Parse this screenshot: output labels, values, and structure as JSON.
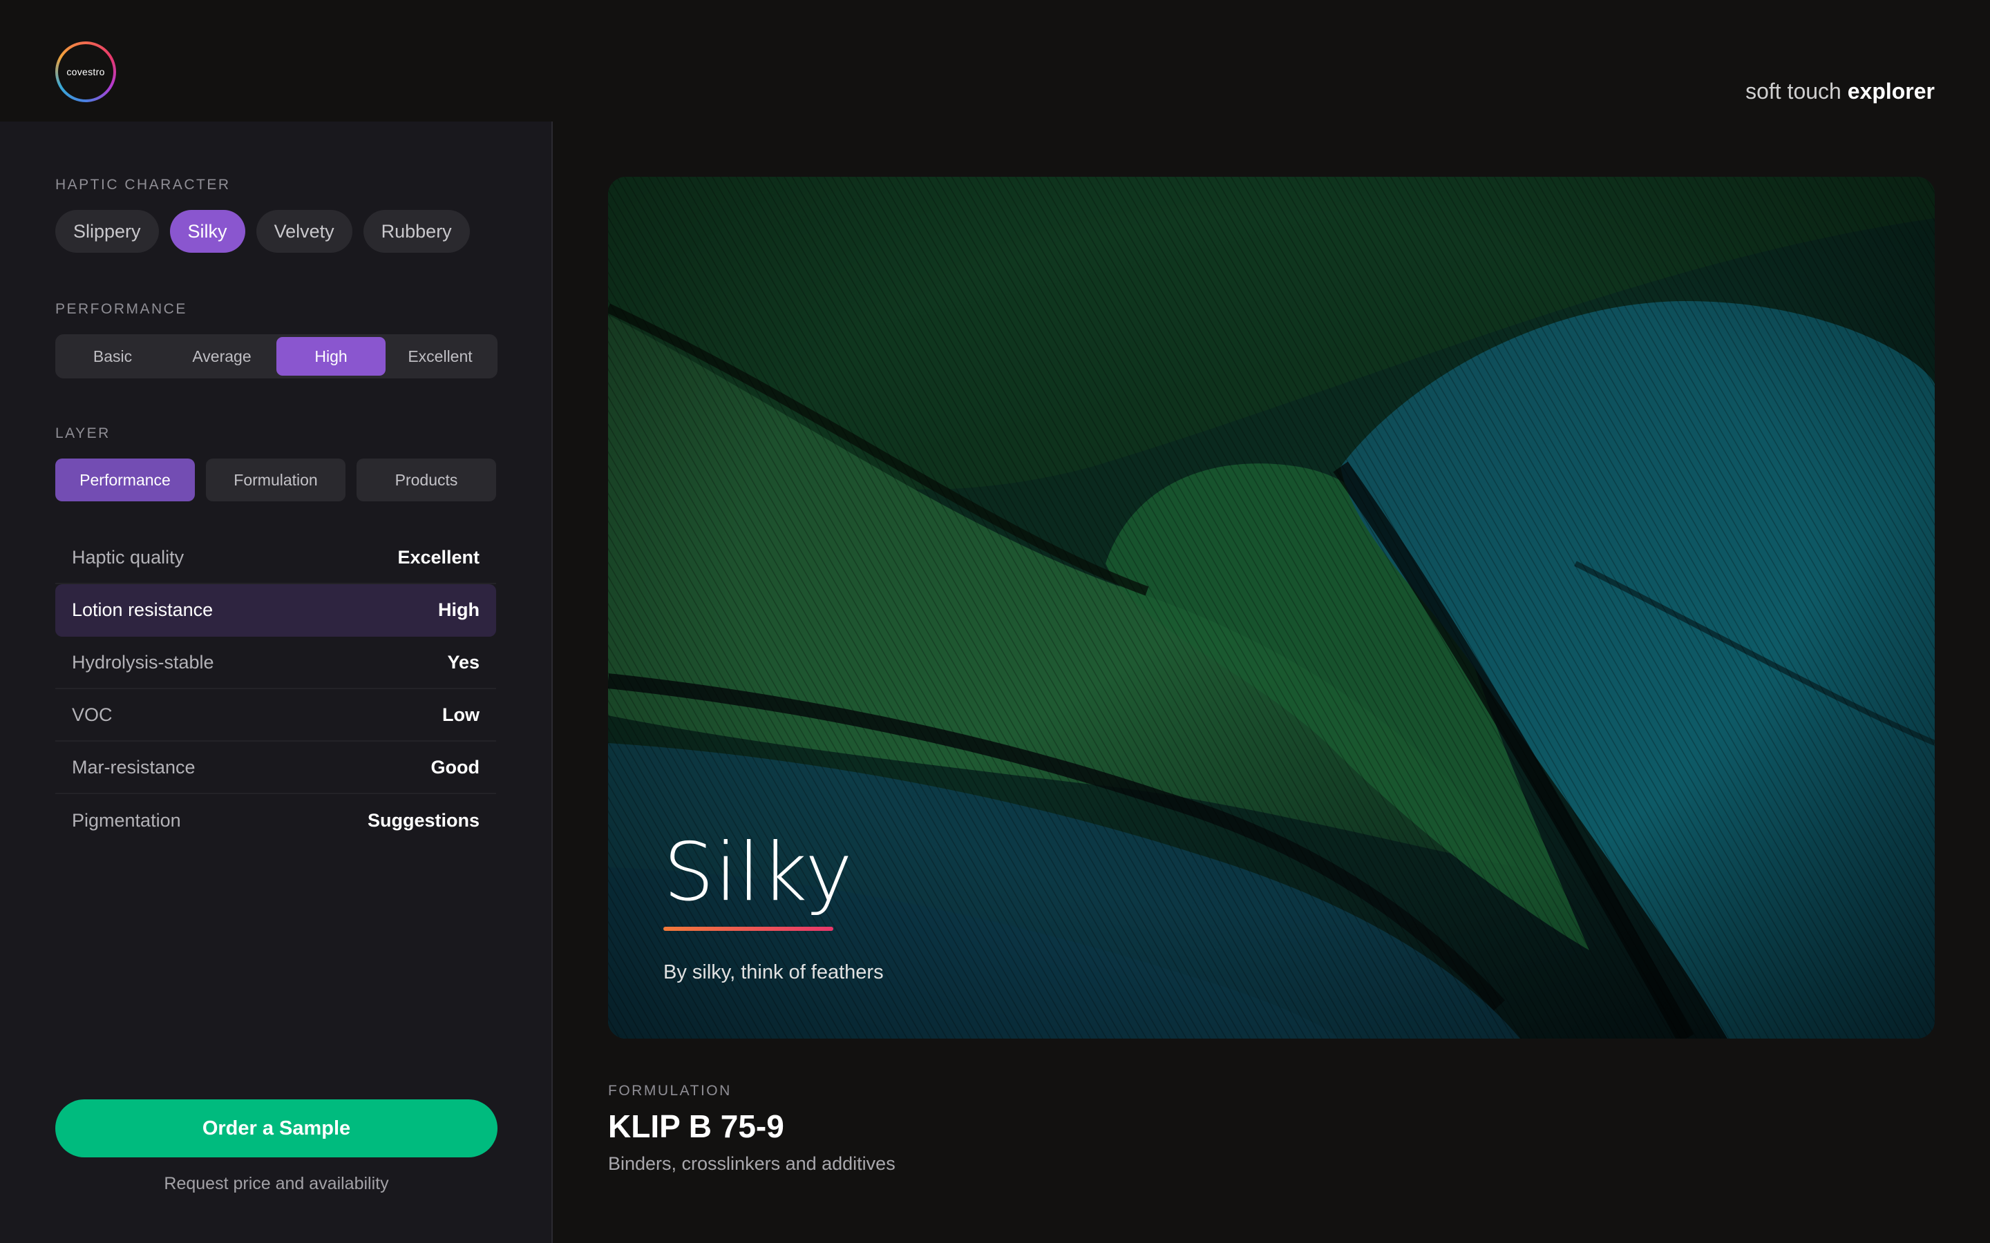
{
  "brand": {
    "logo_text": "covestro",
    "title_light": "soft touch",
    "title_bold": "explorer"
  },
  "sidebar": {
    "haptic": {
      "label": "HAPTIC CHARACTER",
      "options": [
        "Slippery",
        "Silky",
        "Velvety",
        "Rubbery"
      ],
      "selected": "Silky"
    },
    "performance": {
      "label": "PERFORMANCE",
      "options": [
        "Basic",
        "Average",
        "High",
        "Excellent"
      ],
      "selected": "High"
    },
    "layer": {
      "label": "LAYER",
      "options": [
        "Performance",
        "Formulation",
        "Products"
      ],
      "selected": "Performance"
    },
    "properties": [
      {
        "label": "Haptic quality",
        "value": "Excellent"
      },
      {
        "label": "Lotion resistance",
        "value": "High"
      },
      {
        "label": "Hydrolysis-stable",
        "value": "Yes"
      },
      {
        "label": "VOC",
        "value": "Low"
      },
      {
        "label": "Mar-resistance",
        "value": "Good"
      },
      {
        "label": "Pigmentation",
        "value": "Suggestions"
      }
    ],
    "order_button": "Order a Sample",
    "order_subtext": "Request price and availability"
  },
  "hero": {
    "title": "Silky",
    "caption": "By silky, think of feathers"
  },
  "formulation": {
    "label": "FORMULATION",
    "name": "KLIP B 75-9",
    "description": "Binders, crosslinkers and additives"
  },
  "colors": {
    "accent_purple": "#8a56cf",
    "order_green": "#00bb7e",
    "background": "#121110",
    "sidebar": "#19181d"
  }
}
